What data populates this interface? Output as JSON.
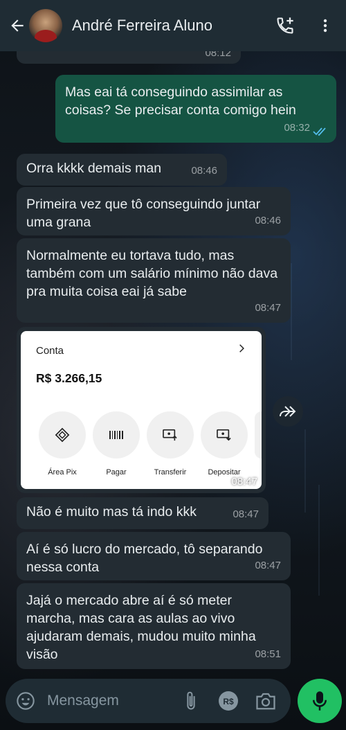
{
  "header": {
    "contact_name": "André Ferreira Aluno",
    "icons": [
      "back-arrow-icon",
      "add-call-icon",
      "more-vertical-icon"
    ]
  },
  "messages": [
    {
      "direction": "in",
      "text": "",
      "time": "08:12"
    },
    {
      "direction": "out",
      "text": "Mas eai tá conseguindo assimilar as coisas? Se precisar conta comigo hein",
      "time": "08:32",
      "status": "read"
    },
    {
      "direction": "in",
      "text": "Orra kkkk demais man",
      "time": "08:46"
    },
    {
      "direction": "in",
      "text": "Primeira vez que tô conseguindo juntar uma grana",
      "time": "08:46"
    },
    {
      "direction": "in",
      "text": "Normalmente eu tortava tudo, mas também com um salário mínimo não dava pra muita coisa eai já sabe",
      "time": "08:47"
    },
    {
      "direction": "in",
      "text": "Não é muito mas tá indo kkk",
      "time": "08:47"
    },
    {
      "direction": "in",
      "text": "Aí é só lucro do mercado, tô separando nessa conta",
      "time": "08:47"
    },
    {
      "direction": "in",
      "text": "Jajá o mercado abre aí é só meter marcha, mas cara as aulas ao vivo ajudaram demais, mudou muito minha visão",
      "time": "08:51"
    }
  ],
  "image_message": {
    "time": "08:47",
    "card": {
      "title": "Conta",
      "balance": "R$ 3.266,15",
      "actions": [
        {
          "label": "Área Pix",
          "icon": "pix-icon"
        },
        {
          "label": "Pagar",
          "icon": "barcode-icon"
        },
        {
          "label": "Transferir",
          "icon": "transfer-icon"
        },
        {
          "label": "Depositar",
          "icon": "deposit-icon"
        }
      ]
    }
  },
  "composer": {
    "placeholder": "Mensagem",
    "icons": [
      "emoji-icon",
      "attach-icon",
      "payment-icon",
      "camera-icon",
      "mic-icon"
    ]
  },
  "colors": {
    "header_bg": "#1f2c34",
    "incoming_bubble": "#232c33",
    "outgoing_bubble": "#155443",
    "read_ticks": "#53bdeb",
    "mic_button": "#21c063"
  }
}
